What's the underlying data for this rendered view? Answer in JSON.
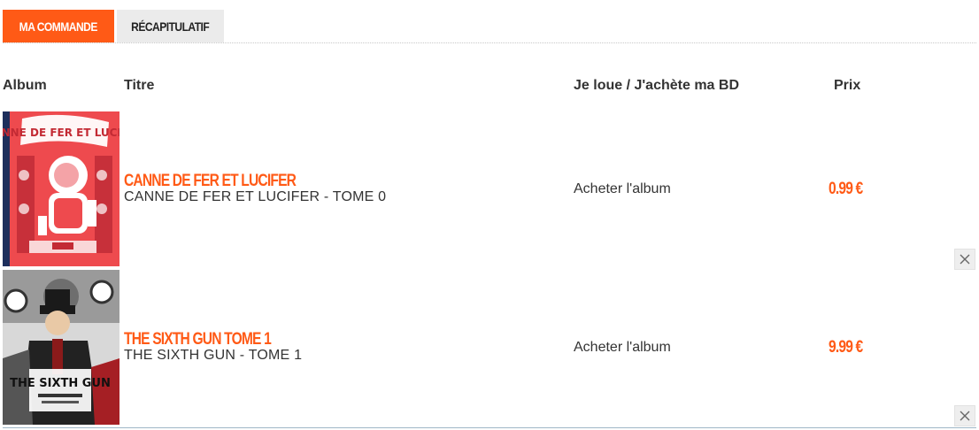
{
  "tabs": {
    "order": "MA COMMANDE",
    "summary": "RÉCAPITULATIF"
  },
  "table": {
    "headers": {
      "album": "Album",
      "title": "Titre",
      "rent_buy": "Je loue / J'achète ma BD",
      "price": "Prix"
    },
    "rows": [
      {
        "cover_title": "CANNE DE FER ET LUCIFER",
        "title": "CANNE DE FER ET LUCIFER",
        "subtitle": "CANNE DE FER ET LUCIFER - TOME 0",
        "action": "Acheter l'album",
        "price": "0.99 €"
      },
      {
        "cover_title": "THE SIXTH GUN",
        "title": "THE SIXTH GUN TOME 1",
        "subtitle": "THE SIXTH GUN - TOME 1",
        "action": "Acheter l'album",
        "price": "9.99 €"
      }
    ]
  },
  "colors": {
    "accent": "#ff5a16",
    "tab_inactive_bg": "#ebebeb",
    "text": "#333333"
  },
  "icons": {
    "remove": "close-icon"
  }
}
